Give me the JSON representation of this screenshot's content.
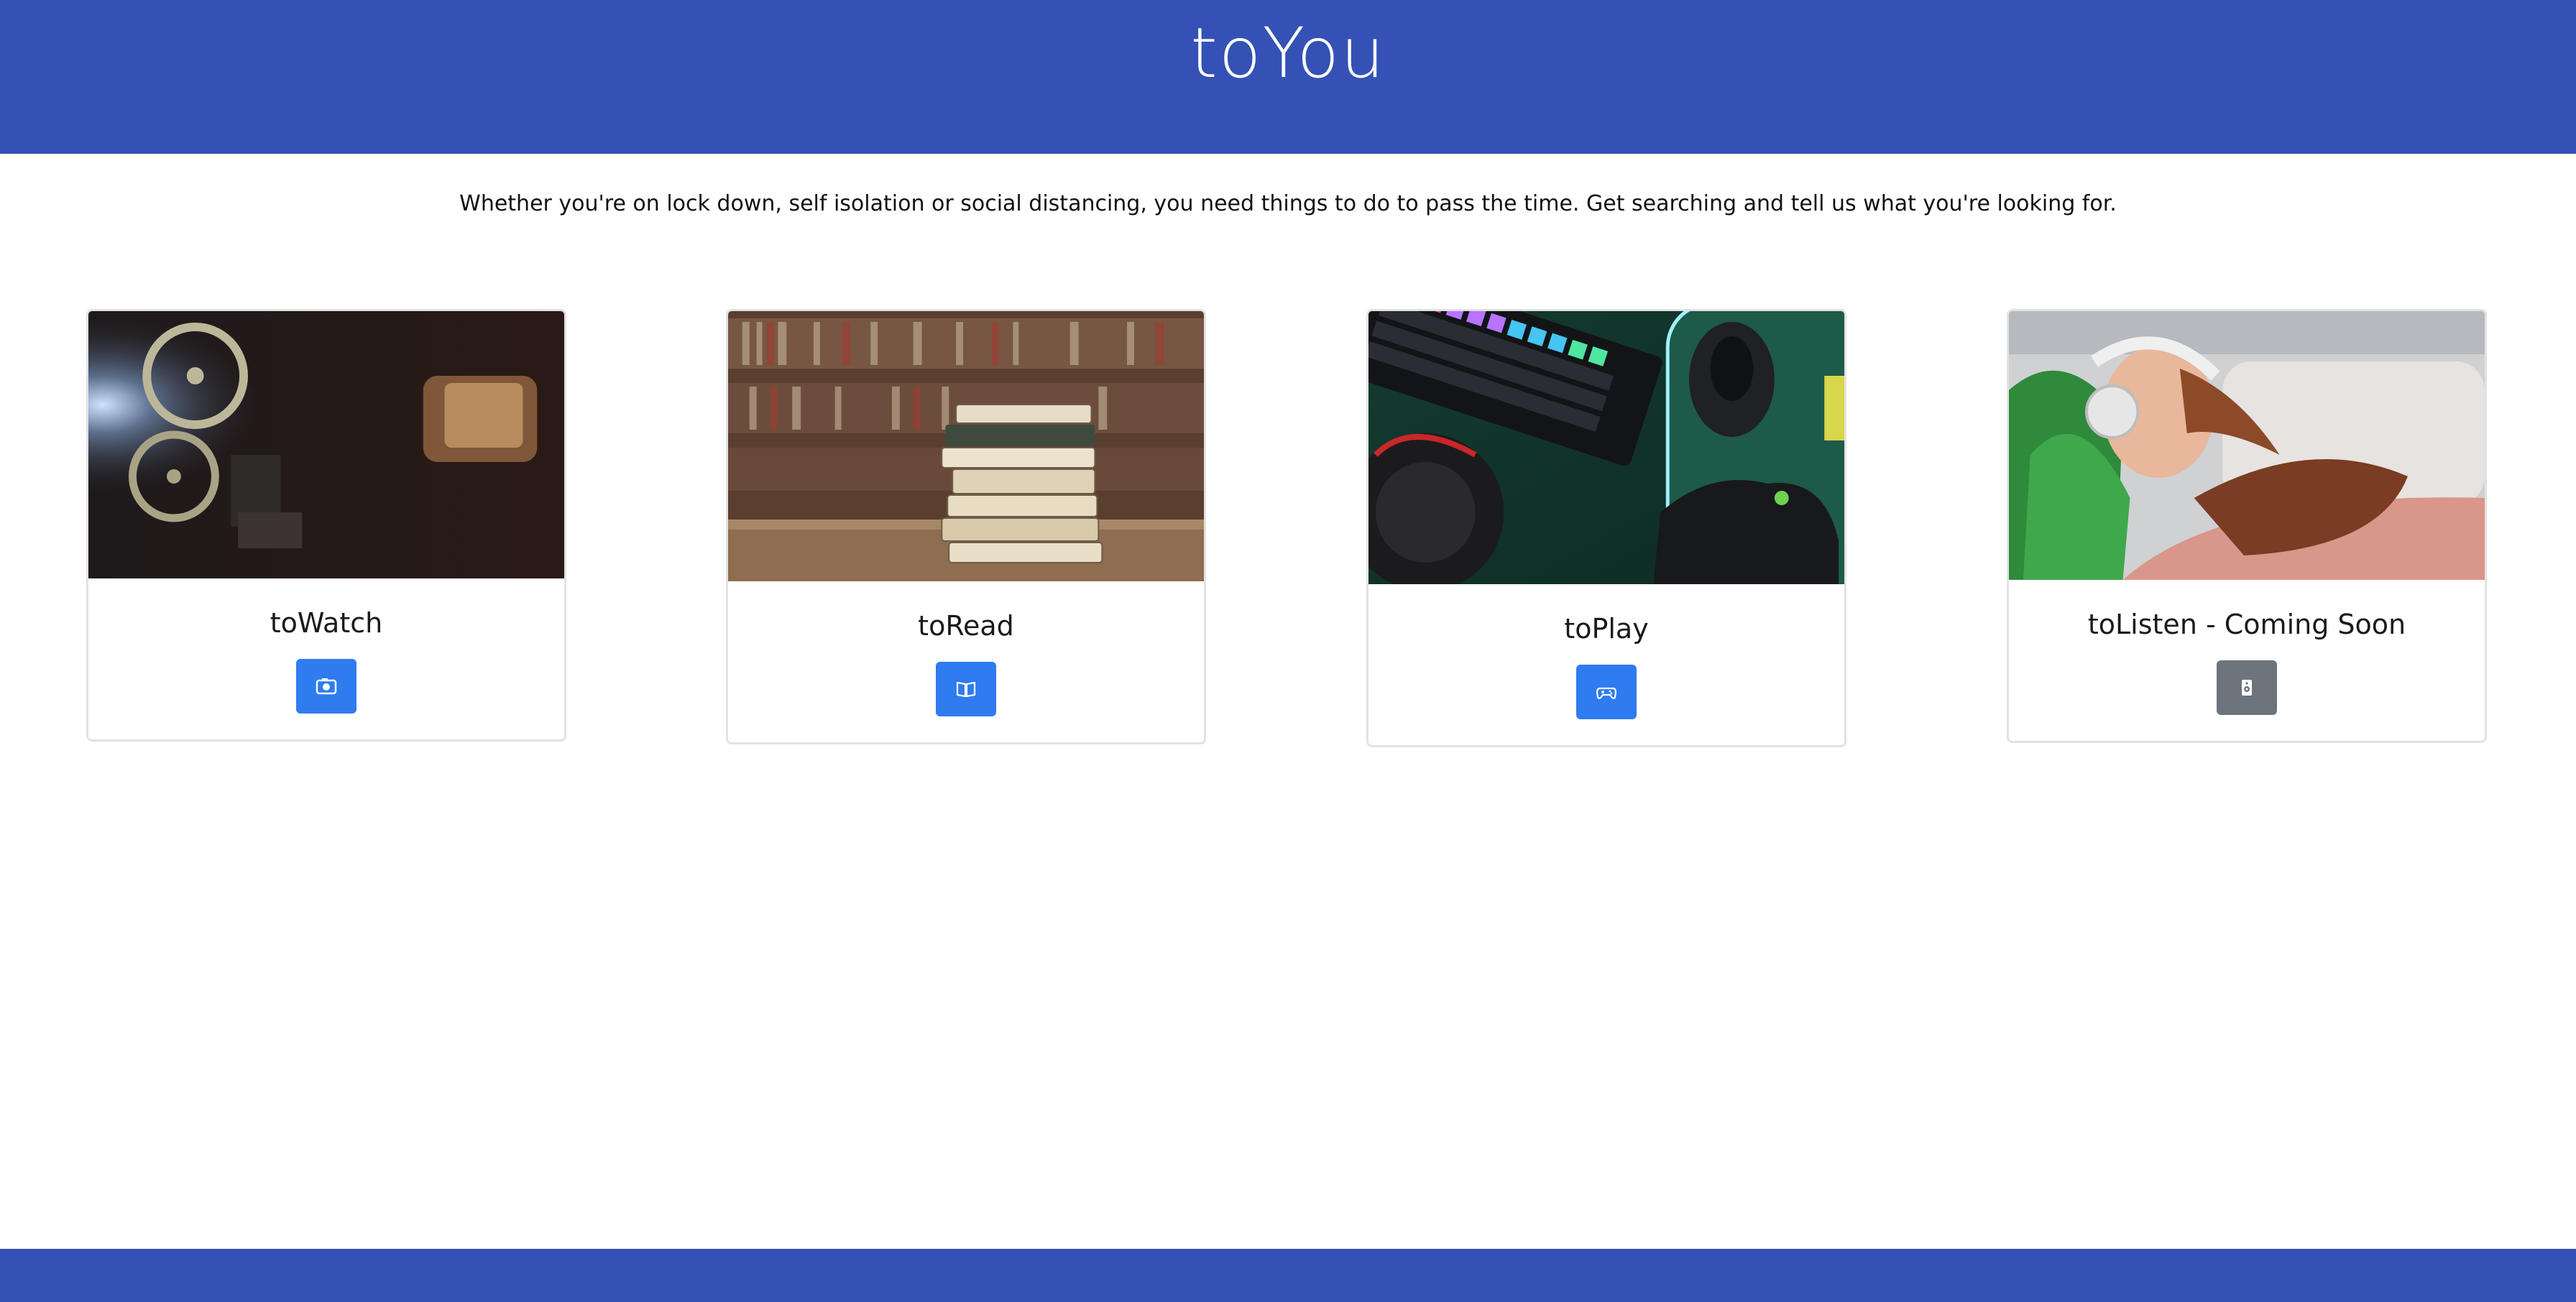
{
  "header": {
    "logo": "toYou",
    "background_color": "#3451b5"
  },
  "intro": {
    "text": "Whether you're on lock down, self isolation or social distancing, you need things to do to pass the time. Get searching and tell us what you're looking for."
  },
  "cards": [
    {
      "title": "toWatch",
      "icon": "film-icon",
      "image": "film-projector-image",
      "button_color": "#2f7bf0"
    },
    {
      "title": "toRead",
      "icon": "book-icon",
      "image": "book-stack-image",
      "button_color": "#2f7bf0"
    },
    {
      "title": "toPlay",
      "icon": "controller-icon",
      "image": "gaming-setup-image",
      "button_color": "#2f7bf0"
    },
    {
      "title": "toListen - Coming Soon",
      "icon": "speaker-icon",
      "image": "woman-headphones-image",
      "button_color": "#6c757d"
    }
  ]
}
